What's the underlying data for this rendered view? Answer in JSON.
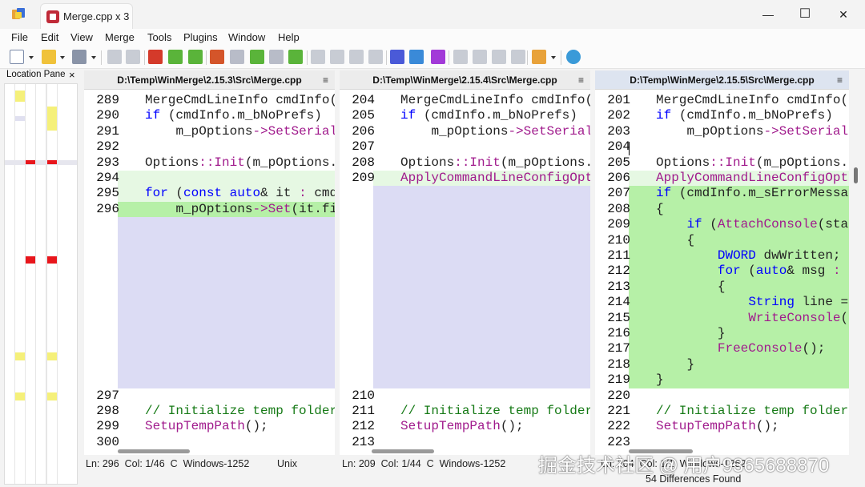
{
  "window": {
    "tab_title": "Merge.cpp x 3",
    "minimize": "—",
    "maximize": "☐",
    "close": "✕"
  },
  "menu": [
    "File",
    "Edit",
    "View",
    "Merge",
    "Tools",
    "Plugins",
    "Window",
    "Help"
  ],
  "location_pane": {
    "title": "Location Pane",
    "close": "×"
  },
  "panes": [
    {
      "path": "D:\\Temp\\WinMerge\\2.15.3\\Src\\Merge.cpp",
      "menu_glyph": "≡",
      "lines": [
        {
          "n": "289",
          "text": "MergeCmdLineInfo cmdInfo(G",
          "hl": ""
        },
        {
          "n": "290",
          "text": "if (cmdInfo.m_bNoPrefs)",
          "hl": ""
        },
        {
          "n": "291",
          "text": "    m_pOptions->SetSerial:",
          "hl": ""
        },
        {
          "n": "292",
          "text": "",
          "hl": ""
        },
        {
          "n": "293",
          "text": "Options::Init(m_pOptions.g",
          "hl": ""
        },
        {
          "n": "294",
          "text": "",
          "hl": "light"
        },
        {
          "n": "295",
          "text": "for (const auto& it : cmdI",
          "hl": "light"
        },
        {
          "n": "296",
          "text": "    m_pOptions->Set(it.fir",
          "hl": "dark"
        },
        {
          "n": "",
          "text": "",
          "hl": "empty"
        },
        {
          "n": "",
          "text": "",
          "hl": "empty"
        },
        {
          "n": "",
          "text": "",
          "hl": "empty"
        },
        {
          "n": "",
          "text": "",
          "hl": "empty"
        },
        {
          "n": "",
          "text": "",
          "hl": "empty"
        },
        {
          "n": "",
          "text": "",
          "hl": "empty"
        },
        {
          "n": "",
          "text": "",
          "hl": "empty"
        },
        {
          "n": "",
          "text": "",
          "hl": "empty"
        },
        {
          "n": "",
          "text": "",
          "hl": "empty"
        },
        {
          "n": "",
          "text": "",
          "hl": "empty"
        },
        {
          "n": "",
          "text": "",
          "hl": "empty"
        },
        {
          "n": "297",
          "text": "",
          "hl": ""
        },
        {
          "n": "298",
          "text": "// Initialize temp folder",
          "hl": ""
        },
        {
          "n": "299",
          "text": "SetupTempPath();",
          "hl": ""
        },
        {
          "n": "300",
          "text": "",
          "hl": ""
        }
      ],
      "status": "Ln: 296  Col: 1/46  C  Windows-1252          Unix"
    },
    {
      "path": "D:\\Temp\\WinMerge\\2.15.4\\Src\\Merge.cpp",
      "menu_glyph": "≡",
      "lines": [
        {
          "n": "204",
          "text": "MergeCmdLineInfo cmdInfo(G",
          "hl": ""
        },
        {
          "n": "205",
          "text": "if (cmdInfo.m_bNoPrefs)",
          "hl": ""
        },
        {
          "n": "206",
          "text": "    m_pOptions->SetSerial:",
          "hl": ""
        },
        {
          "n": "207",
          "text": "",
          "hl": ""
        },
        {
          "n": "208",
          "text": "Options::Init(m_pOptions.g",
          "hl": ""
        },
        {
          "n": "209",
          "text": "ApplyCommandLineConfigOpti",
          "hl": "light"
        },
        {
          "n": "",
          "text": "",
          "hl": "empty"
        },
        {
          "n": "",
          "text": "",
          "hl": "empty"
        },
        {
          "n": "",
          "text": "",
          "hl": "empty"
        },
        {
          "n": "",
          "text": "",
          "hl": "empty"
        },
        {
          "n": "",
          "text": "",
          "hl": "empty"
        },
        {
          "n": "",
          "text": "",
          "hl": "empty"
        },
        {
          "n": "",
          "text": "",
          "hl": "empty"
        },
        {
          "n": "",
          "text": "",
          "hl": "empty"
        },
        {
          "n": "",
          "text": "",
          "hl": "empty"
        },
        {
          "n": "",
          "text": "",
          "hl": "empty"
        },
        {
          "n": "",
          "text": "",
          "hl": "empty"
        },
        {
          "n": "",
          "text": "",
          "hl": "empty"
        },
        {
          "n": "",
          "text": "",
          "hl": "empty"
        },
        {
          "n": "210",
          "text": "",
          "hl": ""
        },
        {
          "n": "211",
          "text": "// Initialize temp folder",
          "hl": ""
        },
        {
          "n": "212",
          "text": "SetupTempPath();",
          "hl": ""
        },
        {
          "n": "213",
          "text": "",
          "hl": ""
        }
      ],
      "status": "Ln: 209  Col: 1/44  C  Windows-1252"
    },
    {
      "path": "D:\\Temp\\WinMerge\\2.15.5\\Src\\Merge.cpp",
      "menu_glyph": "≡",
      "lines": [
        {
          "n": "201",
          "text": "MergeCmdLineInfo cmdInfo(G",
          "hl": ""
        },
        {
          "n": "202",
          "text": "if (cmdInfo.m_bNoPrefs)",
          "hl": ""
        },
        {
          "n": "203",
          "text": "    m_pOptions->SetSeriali",
          "hl": ""
        },
        {
          "n": "204",
          "text": "",
          "hl": ""
        },
        {
          "n": "205",
          "text": "Options::Init(m_pOptions.g",
          "hl": ""
        },
        {
          "n": "206",
          "text": "ApplyCommandLineConfigOpti",
          "hl": "light"
        },
        {
          "n": "207",
          "text": "if (cmdInfo.m_sErrorMessag",
          "hl": "dark"
        },
        {
          "n": "208",
          "text": "{",
          "hl": "dark"
        },
        {
          "n": "209",
          "text": "    if (AttachConsole(stat",
          "hl": "dark"
        },
        {
          "n": "210",
          "text": "    {",
          "hl": "dark"
        },
        {
          "n": "211",
          "text": "        DWORD dwWritten;",
          "hl": "dark"
        },
        {
          "n": "212",
          "text": "        for (auto& msg : c",
          "hl": "dark"
        },
        {
          "n": "213",
          "text": "        {",
          "hl": "dark"
        },
        {
          "n": "214",
          "text": "            String line =",
          "hl": "dark"
        },
        {
          "n": "215",
          "text": "            WriteConsole(G",
          "hl": "dark"
        },
        {
          "n": "216",
          "text": "        }",
          "hl": "dark"
        },
        {
          "n": "217",
          "text": "        FreeConsole();",
          "hl": "dark"
        },
        {
          "n": "218",
          "text": "    }",
          "hl": "dark"
        },
        {
          "n": "219",
          "text": "}",
          "hl": "dark"
        },
        {
          "n": "220",
          "text": "",
          "hl": ""
        },
        {
          "n": "221",
          "text": "// Initialize temp folder",
          "hl": ""
        },
        {
          "n": "222",
          "text": "SetupTempPath();",
          "hl": ""
        },
        {
          "n": "223",
          "text": "",
          "hl": ""
        }
      ],
      "status": "Ln: 204  Col: 1/1  Windows-1252"
    }
  ],
  "status_bar": {
    "differences": "54 Differences Found"
  },
  "watermark": "掘金技术社区 @ 用户9365688870",
  "colors": {
    "diff_light": "#e6f8e3",
    "diff_dark": "#b6f0a7",
    "diff_empty": "#dcdcf4",
    "keyword": "#0000ff",
    "function": "#a01a8c",
    "comment": "#167a16",
    "location_red": "#e8161c",
    "location_yellow": "#f5f07a"
  }
}
